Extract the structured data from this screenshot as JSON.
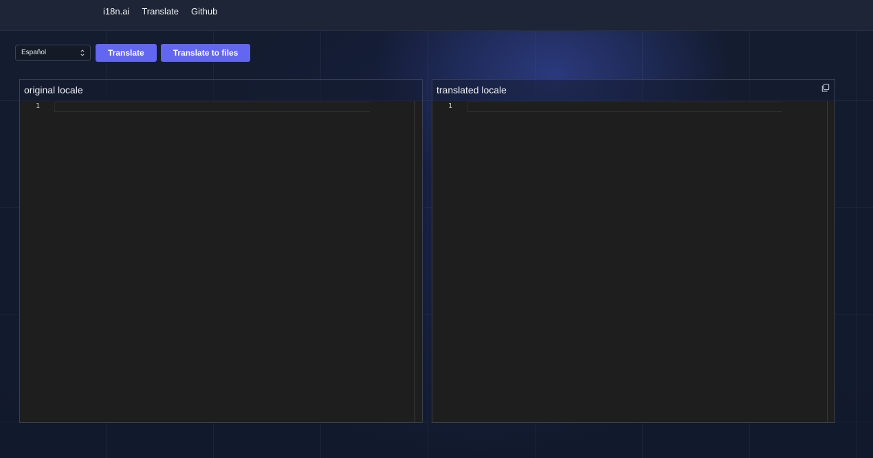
{
  "nav": {
    "brand": "i18n.ai",
    "translate": "Translate",
    "github": "Github"
  },
  "toolbar": {
    "language_select": {
      "selected": "Español"
    },
    "translate_label": "Translate",
    "translate_files_label": "Translate to files"
  },
  "panels": {
    "original": {
      "title": "original locale",
      "line_numbers": [
        "1"
      ],
      "content": ""
    },
    "translated": {
      "title": "translated locale",
      "line_numbers": [
        "1"
      ],
      "content": "",
      "copy_icon": "copy-icon"
    }
  },
  "colors": {
    "accent": "#6366f1",
    "topbar": "#1d2536",
    "editor_bg": "#1e1e1e"
  }
}
